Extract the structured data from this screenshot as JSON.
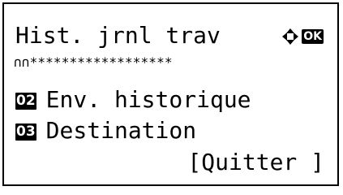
{
  "screen": {
    "title": "Hist. jrnl trav",
    "ok_label": "OK",
    "separator": "∩∩******************"
  },
  "menu": {
    "items": [
      {
        "number": "02",
        "label": "Env. historique"
      },
      {
        "number": "03",
        "label": "Destination"
      }
    ]
  },
  "softkey": {
    "label": "[Quitter ]"
  }
}
